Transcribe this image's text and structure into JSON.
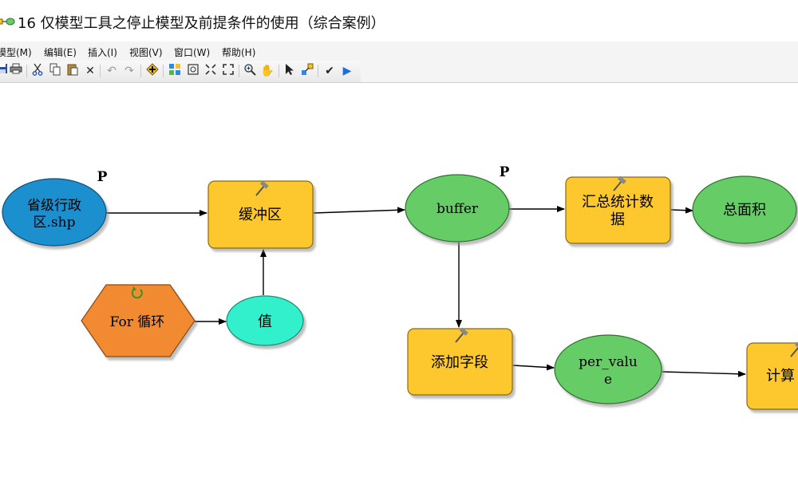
{
  "window": {
    "title": "16 仅模型工具之停止模型及前提条件的使用（综合案例）"
  },
  "menu": {
    "items": [
      "模型(M)",
      "编辑(E)",
      "插入(I)",
      "视图(V)",
      "窗口(W)",
      "帮助(H)"
    ]
  },
  "toolbar": {
    "icons": [
      "save-icon",
      "print-icon",
      "cut-icon",
      "copy-icon",
      "paste-icon",
      "delete-icon",
      "undo-icon",
      "redo-icon",
      "add-data-icon",
      "auto-layout-icon",
      "full-extent-icon",
      "zoom-in-fixed-icon",
      "zoom-full-icon",
      "zoom-tool-icon",
      "pan-icon",
      "select-icon",
      "connect-icon",
      "validate-icon",
      "run-icon"
    ]
  },
  "model": {
    "nodes": {
      "input_shp": "省级行政区.shp",
      "buffer_tool": "缓冲区",
      "buffer_out": "buffer",
      "summary_tool": "汇总统计数据",
      "total_area": "总面积",
      "for_loop": "For 循环",
      "value": "值",
      "add_field": "添加字段",
      "per_value": "per_value",
      "calc_tool": "计算"
    },
    "param_markers": [
      "P",
      "P"
    ],
    "colors": {
      "input": "#1a8fcf",
      "tool": "#fdc82f",
      "derived": "#66cc66",
      "iterator": "#f28a32",
      "value": "#33f0cc"
    }
  }
}
